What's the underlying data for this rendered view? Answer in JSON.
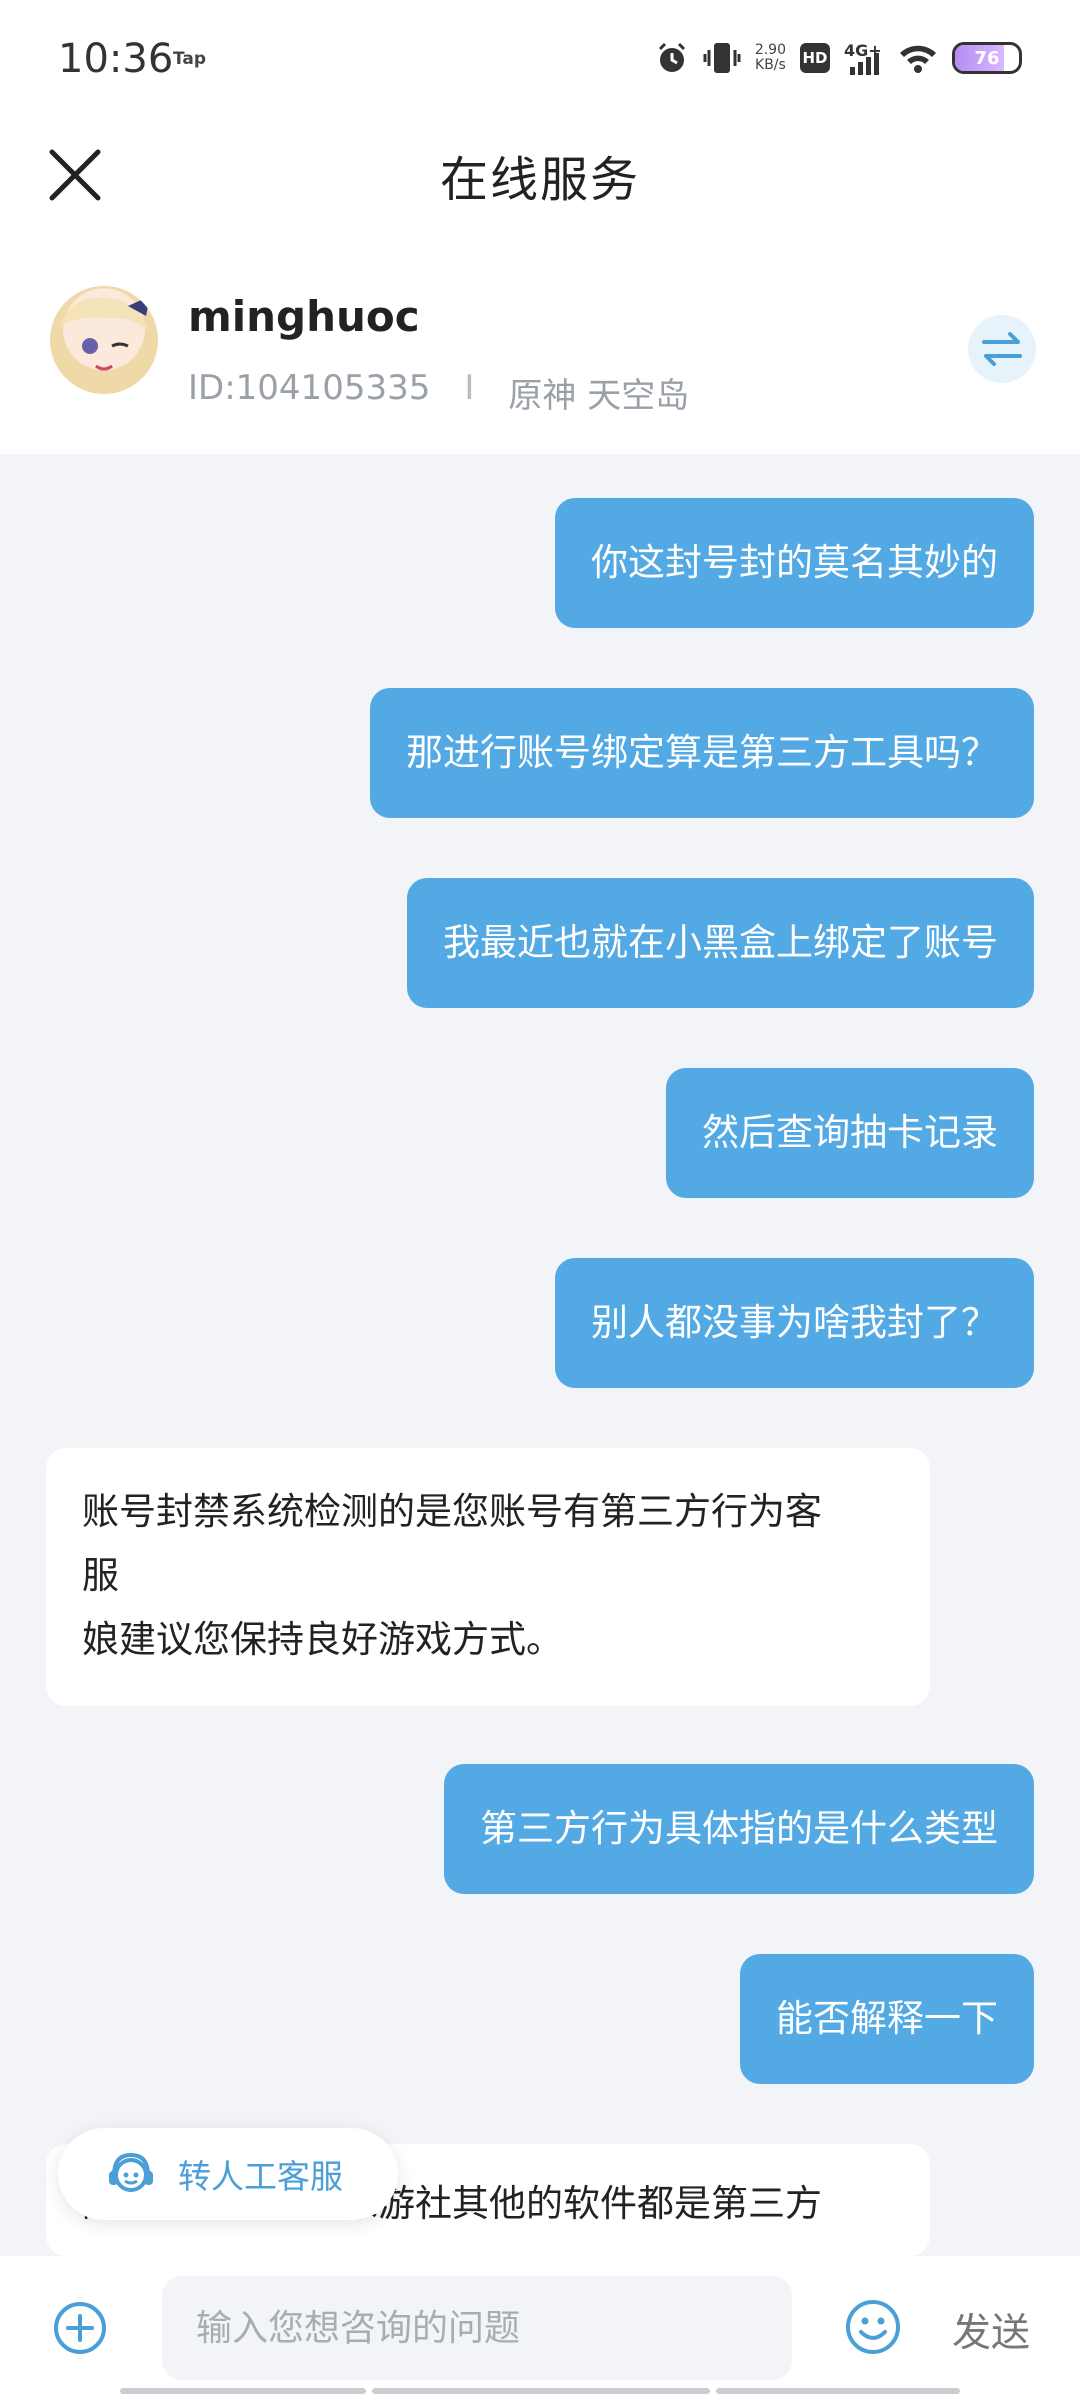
{
  "status_bar": {
    "time": "10:36",
    "tap_label": "Tap",
    "speed_value": "2.90",
    "speed_unit": "KB/s",
    "hd_label": "HD",
    "network_label": "4G+",
    "battery_level": "76",
    "icons": [
      "alarm-icon",
      "vibrate-icon",
      "wifi-icon",
      "battery-icon"
    ]
  },
  "header": {
    "title": "在线服务",
    "close_icon": "close-icon"
  },
  "profile": {
    "username": "minghuoc",
    "user_id": "ID:104105335",
    "separator": "I",
    "server": "原神 天空岛",
    "switch_icon": "swap-icon"
  },
  "messages": [
    {
      "side": "out",
      "text": "你这封号封的莫名其妙的"
    },
    {
      "side": "out",
      "text": "那进行账号绑定算是第三方工具吗？"
    },
    {
      "side": "out",
      "text": "我最近也就在小黑盒上绑定了账号"
    },
    {
      "side": "out",
      "text": "然后查询抽卡记录"
    },
    {
      "side": "out",
      "text": "别人都没事为啥我封了？"
    },
    {
      "side": "in",
      "lines": [
        "账号封禁系统检测的是您账号有第三方行为客",
        "服",
        "娘建议您保持良好游戏方式。"
      ]
    },
    {
      "side": "out",
      "text": "第三方行为具体指的是什么类型"
    },
    {
      "side": "out",
      "text": "能否解释一下"
    },
    {
      "side": "in",
      "lines": [
        "除了官方游戏和米游社其他的软件都是第三方"
      ]
    }
  ],
  "floating_button": {
    "label": "转人工客服",
    "icon": "customer-service-icon"
  },
  "input_bar": {
    "placeholder": "输入您想咨询的问题",
    "send_label": "发送",
    "plus_icon": "plus-circle-icon",
    "emoji_icon": "emoji-icon"
  },
  "colors": {
    "outgoing_bubble": "#53a9e4",
    "incoming_bubble": "#ffffff",
    "background": "#f2f4f7",
    "accent": "#4a9fd8"
  }
}
